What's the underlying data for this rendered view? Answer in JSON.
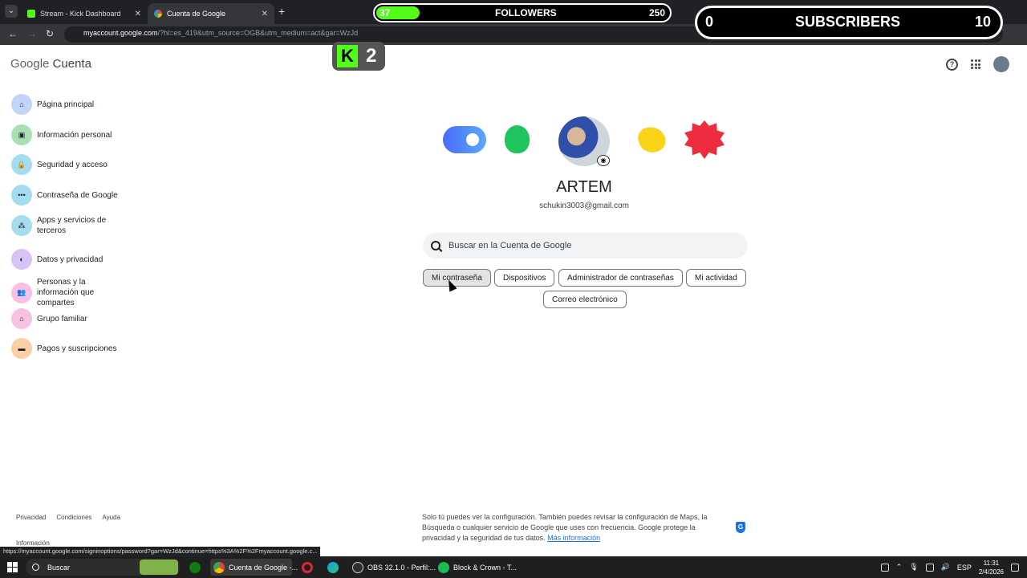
{
  "browser": {
    "tabs": [
      {
        "title": "Stream - Kick Dashboard",
        "favicon": "kick-icon",
        "active": false
      },
      {
        "title": "Cuenta de Google",
        "favicon": "google-icon",
        "active": true
      }
    ],
    "url_host": "myaccount.google.com",
    "url_rest": "/?hl=es_419&utm_source=OGB&utm_medium=act&gar=WzJd"
  },
  "overlay": {
    "followers_current": "37",
    "followers_label": "FOLLOWERS",
    "followers_goal": "250",
    "followers_progress": 0.148,
    "subs_current": "0",
    "subs_label": "SUBSCRIBERS",
    "subs_goal": "10",
    "kick_count": "2"
  },
  "header": {
    "logo_google": "Google",
    "logo_product": "Cuenta"
  },
  "sidebar": {
    "items": [
      {
        "label": "Página principal",
        "icon": "home-icon",
        "color": "#c2d4f8"
      },
      {
        "label": "Información personal",
        "icon": "id-card-icon",
        "color": "#a8e0b4"
      },
      {
        "label": "Seguridad y acceso",
        "icon": "lock-icon",
        "color": "#a6dcef"
      },
      {
        "label": "Contraseña de Google",
        "icon": "dots-icon",
        "color": "#a6dcef"
      },
      {
        "label": "Apps y servicios de terceros",
        "icon": "share-icon",
        "color": "#a6dcef"
      },
      {
        "label": "Datos y privacidad",
        "icon": "toggle-icon",
        "color": "#d8c3f6"
      },
      {
        "label": "Personas y la información que compartes",
        "icon": "people-icon",
        "color": "#f7c1e4"
      },
      {
        "label": "Grupo familiar",
        "icon": "family-icon",
        "color": "#f7c1e4"
      },
      {
        "label": "Pagos y suscripciones",
        "icon": "card-icon",
        "color": "#fbcfa6"
      }
    ]
  },
  "profile": {
    "name": "ARTEM",
    "email": "schukin3003@gmail.com"
  },
  "search": {
    "placeholder": "Buscar en la Cuenta de Google"
  },
  "chips": [
    "Mi contraseña",
    "Dispositivos",
    "Administrador de contraseñas",
    "Mi actividad",
    "Correo electrónico"
  ],
  "footer": {
    "links": [
      "Privacidad",
      "Condiciones",
      "Ayuda"
    ],
    "info": "Información",
    "note": "Solo tú puedes ver la configuración. También puedes revisar la configuración de Maps, la Búsqueda o cualquier servicio de Google que uses con frecuencia. Google protege la privacidad y la seguridad de tus datos.",
    "more_link": "Más información"
  },
  "status_url": "https://myaccount.google.com/signinoptions/password?gar=WzJd&continue=https%3A%2F%2Fmyaccount.google.c...",
  "taskbar": {
    "search_label": "Buscar",
    "apps": [
      {
        "label": "Cuenta de Google -...",
        "icon": "chrome-icon"
      },
      {
        "label": "OBS 32.1.0 - Perfil:...",
        "icon": "obs-icon"
      },
      {
        "label": "Block & Crown - T...",
        "icon": "spotify-icon"
      }
    ],
    "lang": "ESP",
    "time": "11:31",
    "date": "2/4/2026"
  }
}
